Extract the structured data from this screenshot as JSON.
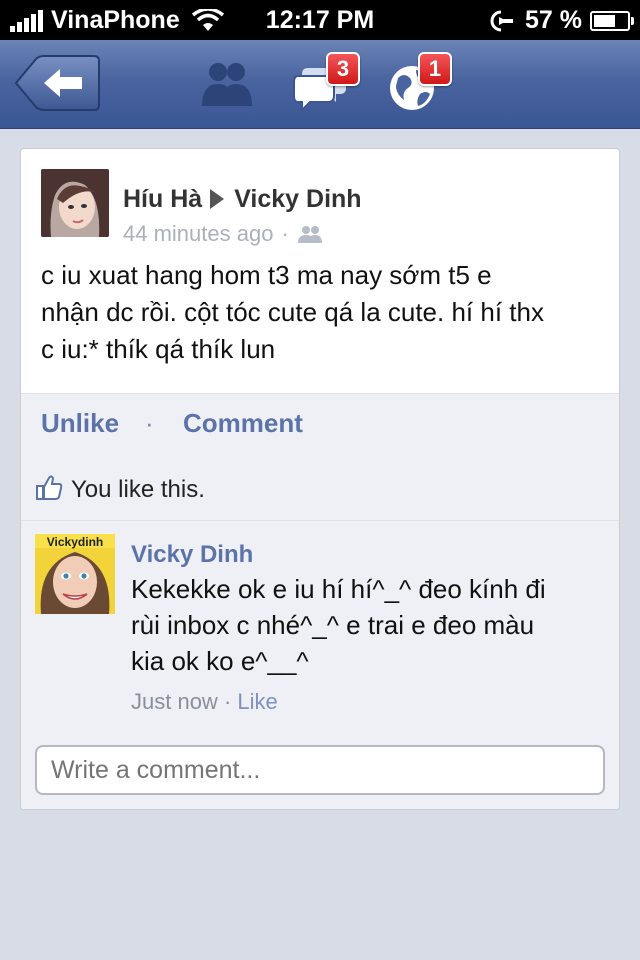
{
  "status_bar": {
    "carrier": "VinaPhone",
    "time": "12:17 PM",
    "battery_percent": "57 %",
    "battery_level": 0.57
  },
  "nav": {
    "icons": [
      "back-arrow-icon",
      "friend-requests-icon",
      "messages-icon",
      "notifications-globe-icon"
    ],
    "messages_badge": "3",
    "notifications_badge": "1",
    "colors": {
      "navbar": "#4a64a0",
      "badge": "#d01818",
      "link": "#5b73a8"
    }
  },
  "post": {
    "author": "Híu Hà",
    "target": "Vicky Dinh",
    "time": "44 minutes ago",
    "meta_separator": "·",
    "privacy_icon": "friends-icon",
    "text_lines": [
      "c iu xuat hang hom t3 ma nay sớm t5 e",
      "nhận dc rồi. cột tóc cute qá la cute. hí hí thx",
      "c iu:* thík qá thík lun"
    ]
  },
  "actions": {
    "unlike_label": "Unlike",
    "separator": "·",
    "comment_label": "Comment"
  },
  "likes": {
    "icon": "thumbs-up-icon",
    "text": "You like this."
  },
  "comment": {
    "author": "Vicky Dinh",
    "avatar_banner": "Vickydinh",
    "text_lines": [
      "Kekekke ok e iu hí hí^_^ đeo kính đi",
      "rùi inbox c nhé^_^ e trai e đeo màu",
      "kia ok ko e^__^"
    ],
    "time": "Just now",
    "meta_separator": " · ",
    "like_label": "Like"
  },
  "composer": {
    "placeholder": "Write a comment..."
  }
}
